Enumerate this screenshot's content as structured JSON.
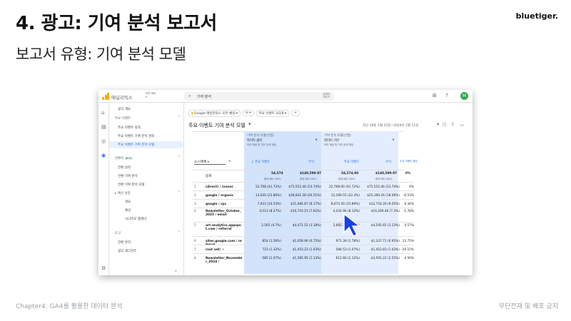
{
  "slide": {
    "title": "4. 광고: 기여 분석 보고서",
    "subtitle": "보고서 유형: 기여 분석 모델",
    "brand": "bluetiger.",
    "footer_left": "Chapter4: GA4를 활용한 데이터 분석",
    "footer_right": "무단전재 및 배포 금지"
  },
  "app": {
    "name": "애널리틱스",
    "account_line1": "모든 계정",
    "account_line2": "▾",
    "search_value": "기여 분석",
    "search_hint_1": "검색어",
    "search_hint_2": "지우기",
    "avatar": "M"
  },
  "sidebar": {
    "items": [
      {
        "label": "광고 개요"
      },
      {
        "label": "주요 이벤트"
      },
      {
        "label": "주요 이벤트 실적"
      },
      {
        "label": "주요 이벤트 기여 분석 경로"
      },
      {
        "label": "주요 이벤트 기여 분석 모델"
      },
      {
        "label": "전환수"
      },
      {
        "label": "전환 실적"
      },
      {
        "label": "전환 기여 분석"
      },
      {
        "label": "전환 기여 분석 모델"
      },
      {
        "label": "예산 설정"
      },
      {
        "label": "개요"
      },
      {
        "label": "예상"
      },
      {
        "label": "시나리오 플래너"
      },
      {
        "label": "도구"
      },
      {
        "label": "전환 관리"
      },
      {
        "label": "광고 세그먼트"
      }
    ],
    "beta": "BETA"
  },
  "report": {
    "filter_chip": "Google 애널리틱스 모든 채널",
    "event_chip": "주요 이벤트 3/3개",
    "title": "주요 이벤트 기여 분석 모델",
    "date_range": "지난 28일 1월 15일~2024년 2월 11일",
    "model1_title": "기여 분석 모델(선접)",
    "model1_name": "마지막 클릭",
    "model1_desc": "모든 채널 및 직전 검색 채널",
    "model2_title": "기여 분석 모델(선접)",
    "model2_name": "데이터 기반",
    "model2_desc": "모든 채널 및 직전 검색 채널",
    "dim_select": "소스/매체",
    "col_events": "↓ 주요 이벤트",
    "col_revenue": "수익",
    "col_events2": "주요 이벤트",
    "col_revenue2": "수익",
    "col_change": "주요 이벤트 증감",
    "total_label": "합계",
    "totals": {
      "ev1": "54,574",
      "rev1": "$140,599.97",
      "ev2": "54,574.00",
      "rev2": "$140,599.97",
      "chg": "0%"
    },
    "totals_sub": {
      "ev1": "총계 대비 100%",
      "rev1": "총계 대비 100%",
      "ev2": "총계 대비 100%",
      "rev2": "총계 대비 100%"
    },
    "rows": [
      {
        "n": "1",
        "dim": "(direct) / (none)",
        "ev1": "22,768 (41.72%)",
        "rev1": "$75,552.46 (53.74%)",
        "ev2": "22,768.00 (41.72%)",
        "rev2": "$75,552.46 (53.74%)",
        "chg": "0%"
      },
      {
        "n": "2",
        "dim": "google / organic",
        "ev1": "13,020 (23.86%)",
        "rev1": "$28,841.38 (20.51%)",
        "ev2": "12,169.55 (22.3%)",
        "rev2": "$25,390.26 (18.06%)",
        "chg": "-6.53%"
      },
      {
        "n": "3",
        "dim": "google / cpc",
        "ev1": "7,933 (14.54%)",
        "rev1": "$11,484.87 (8.17%)",
        "ev2": "8,674.30 (15.89%)",
        "rev2": "$12,718.20 (9.05%)",
        "chg": "9.34%"
      },
      {
        "n": "4",
        "dim": "Newsletter_October_2025 / email",
        "ev1": "4,513 (8.27%)",
        "rev1": "$10,710.15 (7.62%)",
        "ev2": "4,432.96 (8.12%)",
        "rev2": "$10,269.46 (7.3%)",
        "chg": "-1.78%"
      },
      {
        "n": "5",
        "dim": "art-analytics.appspot.com / referral",
        "ev1": "2,565 (4.7%)",
        "rev1": "$4,471.52 (3.18%)",
        "ev2": "2,682.31 (4.91%)",
        "rev2": "$4,545.65 (3.23%)",
        "chg": "4.57%"
      },
      {
        "n": "6",
        "dim": "sites.google.com / referral",
        "ev1": "854 (1.56%)",
        "rev1": "$1,058.96 (0.75%)",
        "ev2": "971.39 (1.78%)",
        "rev2": "$1,337.71 (0.95%)",
        "chg": "13.75%"
      },
      {
        "n": "7",
        "dim": "(not set) ⚠",
        "ev1": "723 (1.32%)",
        "rev1": "$1,453.23 (1.03%)",
        "ev2": "584.53 (1.07%)",
        "rev2": "$1,453.83 (1.03%)",
        "chg": "-19.15%"
      },
      {
        "n": "8",
        "dim": "Newsletter_November_2024 /",
        "ev1": "585 (1.07%)",
        "rev1": "$1,585.95 (1.13%)",
        "ev2": "611.66 (1.12%)",
        "rev2": "$3,591.22 (2.55%)",
        "chg": "4.56%"
      }
    ]
  }
}
